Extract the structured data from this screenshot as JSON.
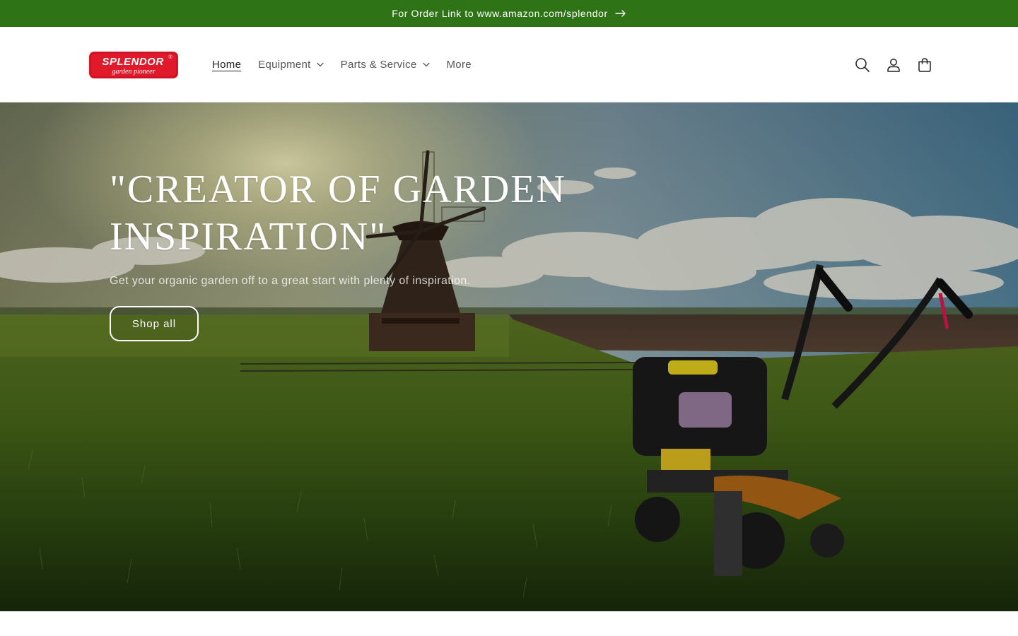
{
  "theme": {
    "announcement_bg": "#2e7416",
    "accent_red": "#e0192b",
    "text_dark": "#121212",
    "text_muted": "#555555"
  },
  "announcement": {
    "text": "For Order Link to www.amazon.com/splendor",
    "icon": "arrow-right-icon"
  },
  "header": {
    "logo": {
      "brand": "SPLENDOR",
      "tagline": "garden pioneer",
      "mark": "®"
    },
    "nav": [
      {
        "label": "Home",
        "active": true,
        "has_dropdown": false
      },
      {
        "label": "Equipment",
        "active": false,
        "has_dropdown": true
      },
      {
        "label": "Parts & Service",
        "active": false,
        "has_dropdown": true
      },
      {
        "label": "More",
        "active": false,
        "has_dropdown": false
      }
    ],
    "icons": [
      "search-icon",
      "account-icon",
      "cart-icon"
    ]
  },
  "hero": {
    "title_line1": "\"CREATOR OF GARDEN",
    "title_line2": "INSPIRATION\"",
    "subtitle": "Get your organic garden off to a great start with plenty of inspiration.",
    "button_label": "Shop all"
  }
}
